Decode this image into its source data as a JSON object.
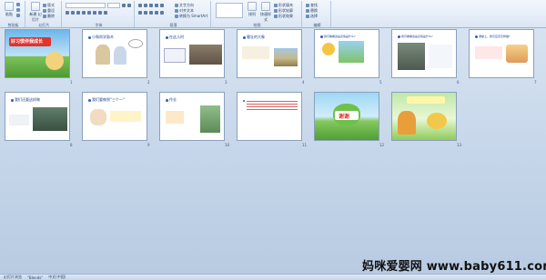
{
  "ribbon": {
    "groups": [
      {
        "label": "剪贴板"
      },
      {
        "label": "幻灯片"
      },
      {
        "label": "字体"
      },
      {
        "label": "段落"
      },
      {
        "label": "绘图"
      },
      {
        "label": "编辑"
      }
    ],
    "new_slide": "新建\n幻灯片",
    "paste": "粘贴",
    "layout": "版式",
    "reset": "重设",
    "delete": "删除",
    "text_direction": "文字方向",
    "align_text": "对齐文本",
    "convert_smartart": "转换为 SmartArt",
    "shapes": "形状",
    "arrange": "排列",
    "quick_styles": "快速样式",
    "shape_fill": "形状填充",
    "shape_outline": "形状轮廓",
    "shape_effects": "形状效果",
    "find": "查找",
    "replace": "替换",
    "select": "选择"
  },
  "slides": [
    {
      "num": "1",
      "title": "好习惯伴我成长"
    },
    {
      "num": "2",
      "title": "小和尚学敲木"
    },
    {
      "num": "3",
      "title": "在这儿时"
    },
    {
      "num": "4",
      "title": "健壮的大象"
    },
    {
      "num": "5",
      "title": "我们看看这是表情是什么?"
    },
    {
      "num": "6",
      "title": "我们看看这是表情是什么?"
    },
    {
      "num": "7",
      "title": "课堂上，我们应该怎样做?"
    },
    {
      "num": "8",
      "title": "我们还要这样做"
    },
    {
      "num": "9",
      "title": "我们要做到\"三个一\""
    },
    {
      "num": "10",
      "title": "作业"
    },
    {
      "num": "11",
      "title": ""
    },
    {
      "num": "12",
      "title": "谢谢"
    },
    {
      "num": "13",
      "title": ""
    }
  ],
  "status": {
    "slide_sorter": "幻灯片浏览",
    "theme": "\"Blends\"",
    "language": "中文(中国)"
  },
  "watermark": "妈咪爱婴网 www.baby611.com"
}
